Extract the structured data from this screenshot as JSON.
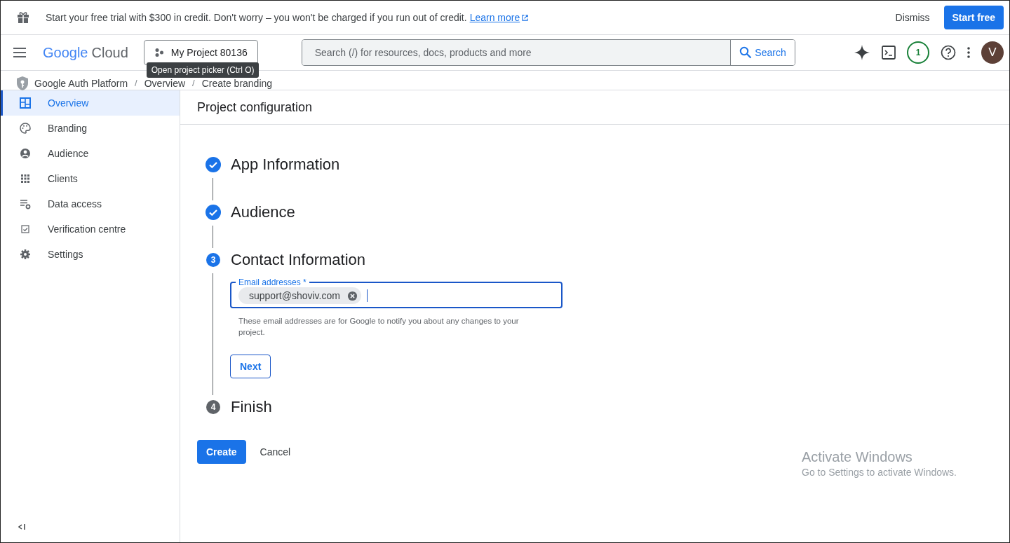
{
  "banner": {
    "text": "Start your free trial with $300 in credit. Don't worry – you won't be charged if you run out of credit.",
    "link": "Learn more",
    "dismiss": "Dismiss",
    "start": "Start free"
  },
  "header": {
    "logo_google": "Google",
    "logo_cloud": "Cloud",
    "project": "My Project 80136",
    "tooltip": "Open project picker (Ctrl O)",
    "search_placeholder": "Search (/) for resources, docs, products and more",
    "search_button": "Search",
    "notifications": "1",
    "avatar": "V"
  },
  "breadcrumb": [
    {
      "kind": "link",
      "text": "Google Auth Platform"
    },
    {
      "kind": "separator",
      "text": "/"
    },
    {
      "kind": "link",
      "text": "Overview"
    },
    {
      "kind": "separator",
      "text": "/"
    },
    {
      "kind": "link",
      "text": "Create branding"
    }
  ],
  "sidebar": {
    "items": [
      {
        "label": "Overview",
        "selected": true
      },
      {
        "label": "Branding",
        "selected": false
      },
      {
        "label": "Audience",
        "selected": false
      },
      {
        "label": "Clients",
        "selected": false
      },
      {
        "label": "Data access",
        "selected": false
      },
      {
        "label": "Verification centre",
        "selected": false
      },
      {
        "label": "Settings",
        "selected": false
      }
    ]
  },
  "page_title": "Project configuration",
  "steps": [
    {
      "title": "App Information",
      "kind": "done"
    },
    {
      "title": "Audience",
      "kind": "done"
    },
    {
      "title": "Contact Information",
      "kind": "current",
      "number": "3"
    },
    {
      "title": "Finish",
      "kind": "pending",
      "number": "4"
    }
  ],
  "email_field": {
    "label": "Email addresses *",
    "chips": [
      "support@shoviv.com"
    ],
    "hint": "These email addresses are for Google to notify you about any changes to your project."
  },
  "next_button": "Next",
  "actions": {
    "create": "Create",
    "cancel": "Cancel"
  },
  "os_overlay": {
    "title": "Activate Windows",
    "subtitle": "Go to Settings to activate Windows."
  }
}
